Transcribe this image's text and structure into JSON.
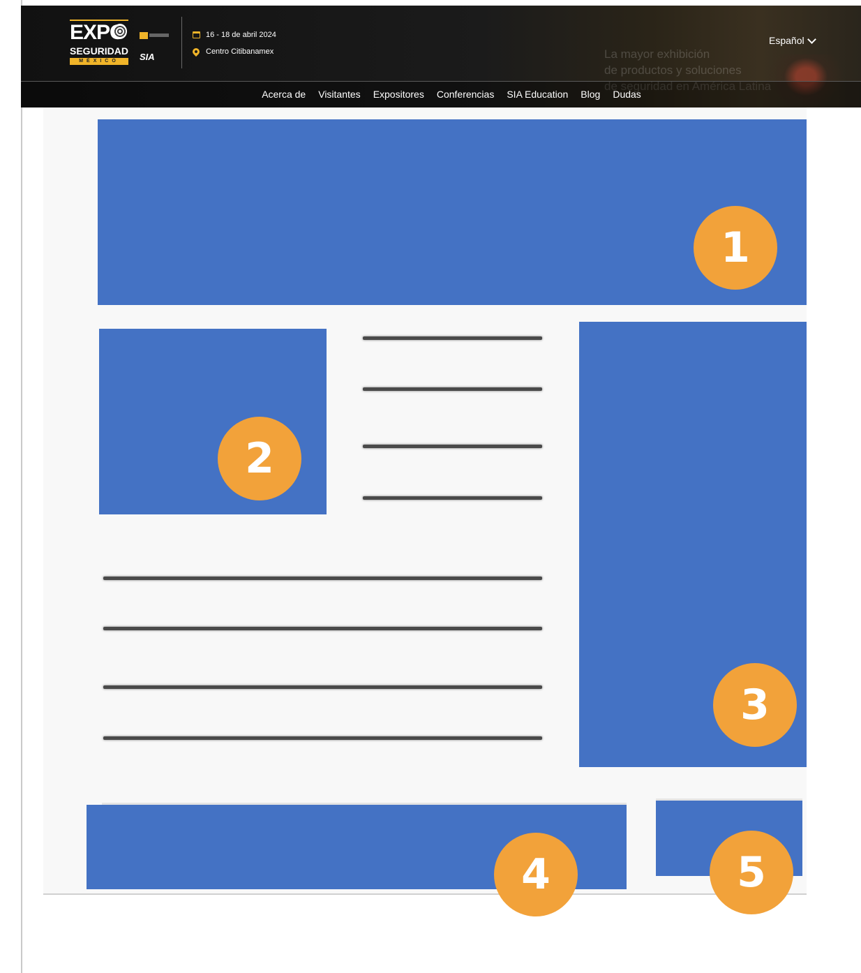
{
  "header": {
    "logo": {
      "line1": "EXPO",
      "line2": "SEGURIDAD",
      "line3": "MÉXICO"
    },
    "partner_2": "SIA",
    "event_date": "16 - 18 de abril 2024",
    "event_place": "Centro Citibanamex",
    "language": "Español",
    "tagline": "La mayor exhibición\nde productos y soluciones\nde seguridad en América Latina",
    "nav": [
      "Acerca de",
      "Visitantes",
      "Expositores",
      "Conferencias",
      "SIA Education",
      "Blog",
      "Dudas"
    ]
  },
  "wireframe": {
    "block_color": "#4472c4",
    "badge_color": "#f2a23a",
    "badges": [
      "1",
      "2",
      "3",
      "4",
      "5"
    ]
  },
  "icons": {
    "date": "calendar-icon",
    "place": "location-pin-icon",
    "language": "chevron-down-icon"
  }
}
